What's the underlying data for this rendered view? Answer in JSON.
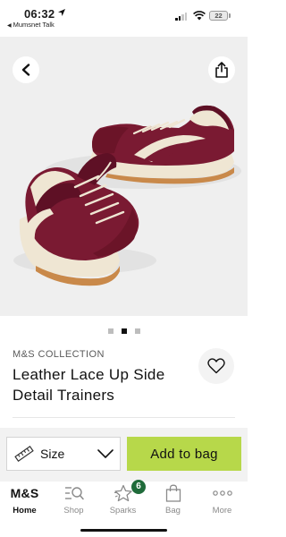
{
  "status_bar": {
    "time": "06:32",
    "back_app": "Mumsnet Talk",
    "battery": "22"
  },
  "product": {
    "collection": "M&S COLLECTION",
    "title": "Leather Lace Up Side Detail Trainers",
    "image_count": 3,
    "active_image": 2,
    "colors": {
      "burgundy": "#7a1a32",
      "cream": "#efe6d3",
      "sole_gum": "#c9894a"
    }
  },
  "actions": {
    "size_label": "Size",
    "add_to_bag_label": "Add to bag",
    "accent_color": "#b7d84a"
  },
  "tabs": [
    {
      "label": "Home",
      "icon": "ms-logo",
      "logo_text": "M&S",
      "active": true
    },
    {
      "label": "Shop",
      "icon": "search-lines-icon",
      "active": false
    },
    {
      "label": "Sparks",
      "icon": "sparks-star-icon",
      "active": false,
      "badge": "6"
    },
    {
      "label": "Bag",
      "icon": "bag-icon",
      "active": false
    },
    {
      "label": "More",
      "icon": "more-dots-icon",
      "active": false
    }
  ]
}
